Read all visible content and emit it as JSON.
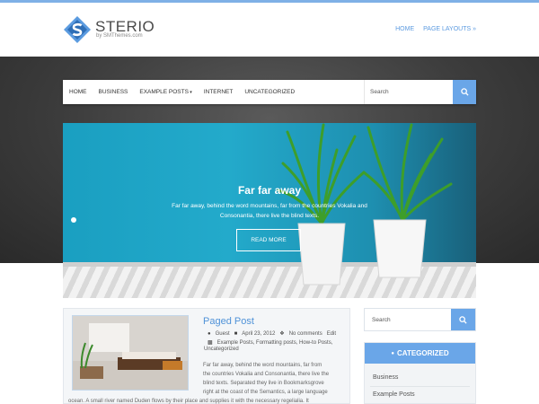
{
  "header": {
    "site_title": "STERIO",
    "site_subtitle": "by SMThemes.com",
    "top_menu": [
      "HOME",
      "PAGE LAYOUTS »"
    ]
  },
  "nav": {
    "items": [
      "HOME",
      "BUSINESS",
      "EXAMPLE POSTS",
      "INTERNET",
      "UNCATEGORIZED"
    ],
    "search_placeholder": "Search"
  },
  "slider": {
    "title": "Far far away",
    "text": "Far far away, behind the word mountains, far from the countries Vokalia and Consonantia, there live the blind texts.",
    "button": "READ MORE"
  },
  "post": {
    "title": "Paged Post",
    "author": "Guest",
    "date": "April 23, 2012",
    "comments": "No comments",
    "edit": "Edit",
    "categories": "Example Posts, Formatting posts, How-to Posts,",
    "categories_2": "Uncategorized",
    "body_lines": [
      "Far far away, behind the word mountains, far from",
      "the countries Vokalia and Consonantia, there live the",
      "blind texts. Separated they live in Bookmarksgrove",
      "right at the coast of the Semantics, a large language",
      "ocean. A small river named Duden flows by their place and supplies it with the necessary regelialia. It"
    ]
  },
  "sidebar": {
    "search_placeholder": "Search",
    "widget_title": "CATEGORIZED",
    "categories": [
      "Business",
      "Example Posts"
    ]
  },
  "colors": {
    "accent": "#6aa6e8",
    "link": "#4f92d8",
    "dark_band": "#3c3c3c",
    "slide_blue": "#1fa3c4"
  }
}
